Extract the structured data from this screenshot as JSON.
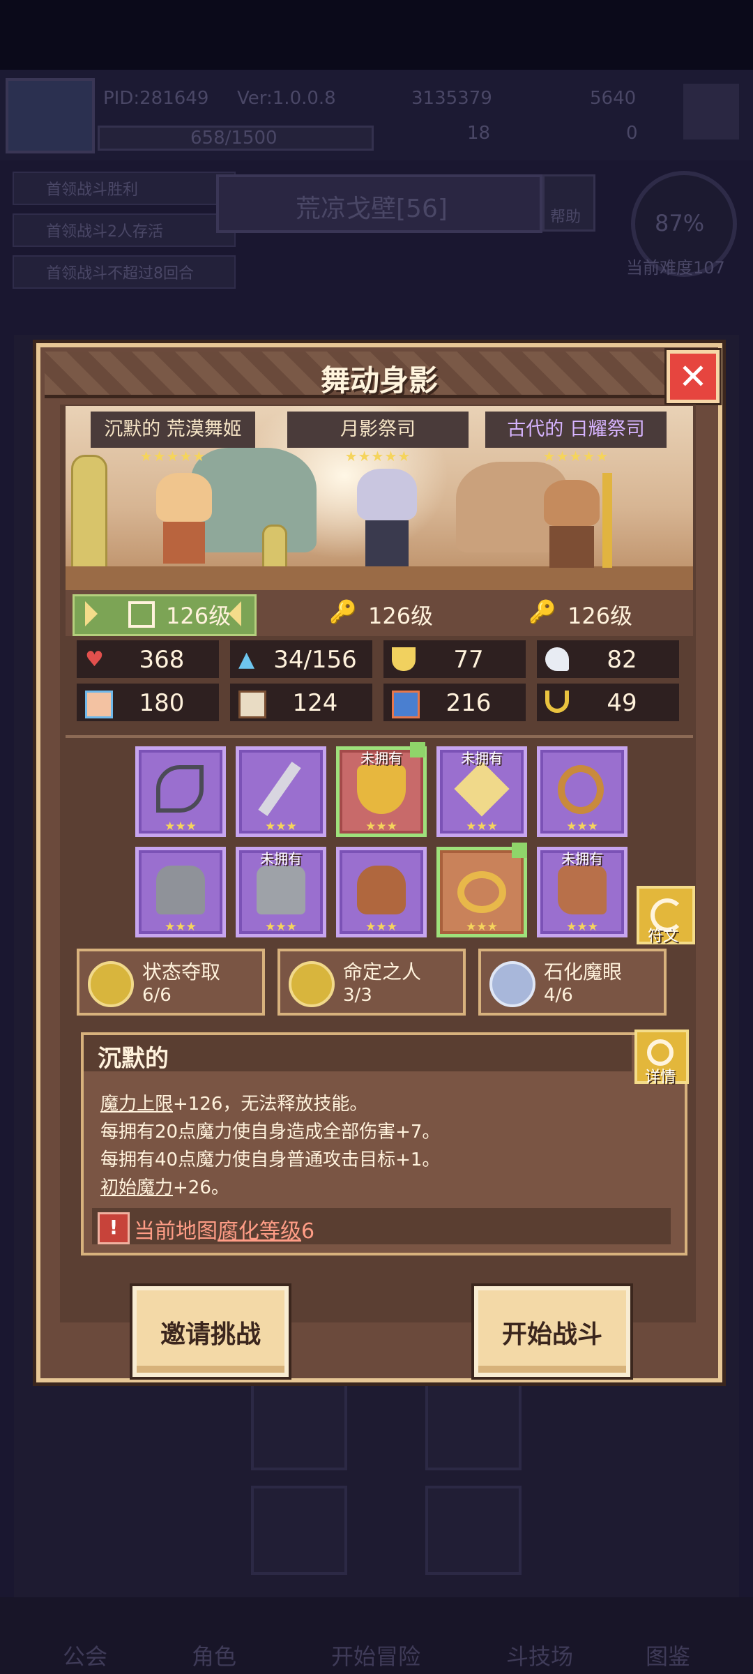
{
  "background": {
    "pid": "PID:281649",
    "version": "Ver:1.0.0.8",
    "gold": "3135379",
    "gems": "5640",
    "exp": "658/1500",
    "keys": "18",
    "tickets": "0",
    "tasks": [
      "首领战斗胜利",
      "首领战斗2人存活",
      "首领战斗不超过8回合"
    ],
    "location": "荒凉戈壁[56]",
    "help": "帮助",
    "progress": "87%",
    "difficulty": "当前难度107",
    "nav": [
      "公会",
      "角色",
      "开始冒险",
      "斗技场",
      "图鉴"
    ]
  },
  "dialog": {
    "title": "舞动身影",
    "heroes": [
      {
        "name": "沉默的 荒漠舞姬",
        "stars": "★★★★★",
        "level": "126级",
        "name_color": "#f6e5c6"
      },
      {
        "name": "月影祭司",
        "stars": "★★★★★",
        "level": "126级",
        "name_color": "#f6e5c6"
      },
      {
        "name": "古代的 日耀祭司",
        "stars": "★★★★★",
        "level": "126级",
        "name_color": "#d7b4ff"
      }
    ],
    "stats": [
      {
        "icon": "heart-icon",
        "value": "368"
      },
      {
        "icon": "mana-drop-icon",
        "value": "34/156"
      },
      {
        "icon": "shield-icon",
        "value": "77"
      },
      {
        "icon": "wing-icon",
        "value": "82"
      },
      {
        "icon": "fist-icon",
        "value": "180"
      },
      {
        "icon": "book-icon",
        "value": "124"
      },
      {
        "icon": "boot-icon",
        "value": "216"
      },
      {
        "icon": "horseshoe-icon",
        "value": "49"
      }
    ],
    "equipment_row1": [
      {
        "icon": "bow-icon",
        "stars": "★★★",
        "tag": "",
        "rarity": "purple"
      },
      {
        "icon": "dagger-icon",
        "stars": "★★★",
        "tag": "",
        "rarity": "purple"
      },
      {
        "icon": "amulet-icon",
        "stars": "★★★",
        "tag": "未拥有",
        "rarity": "red"
      },
      {
        "icon": "crystal-icon",
        "stars": "★★★",
        "tag": "未拥有",
        "rarity": "purple"
      },
      {
        "icon": "ring-icon",
        "stars": "★★★",
        "tag": "",
        "rarity": "purple"
      }
    ],
    "equipment_row2": [
      {
        "icon": "armor-icon",
        "stars": "★★★",
        "tag": "",
        "rarity": "purple"
      },
      {
        "icon": "chest-armor-icon",
        "stars": "★★★",
        "tag": "未拥有",
        "rarity": "purple"
      },
      {
        "icon": "gauntlet-icon",
        "stars": "★★★",
        "tag": "",
        "rarity": "purple"
      },
      {
        "icon": "necklace-icon",
        "stars": "★★★",
        "tag": "",
        "rarity": "orange"
      },
      {
        "icon": "boots-icon",
        "stars": "★★★",
        "tag": "未拥有",
        "rarity": "purple"
      }
    ],
    "rune_label": "符文",
    "sets": [
      {
        "name": "状态夺取",
        "count": "6/6"
      },
      {
        "name": "命定之人",
        "count": "3/3"
      },
      {
        "name": "石化魔眼",
        "count": "4/6"
      }
    ],
    "description": {
      "title": "沉默的",
      "detail_label": "详情",
      "line1_key": "魔力上限",
      "line1_rest": "+126，无法释放技能。",
      "line2": "每拥有20点魔力使自身造成全部伤害+7。",
      "line3": "每拥有40点魔力使自身普通攻击目标+1。",
      "line4_key": "初始魔力",
      "line4_rest": "+26。",
      "warning_pre": "当前地图",
      "warning_key": "腐化等级",
      "warning_post": "6"
    },
    "invite_label": "邀请挑战",
    "start_label": "开始战斗"
  }
}
